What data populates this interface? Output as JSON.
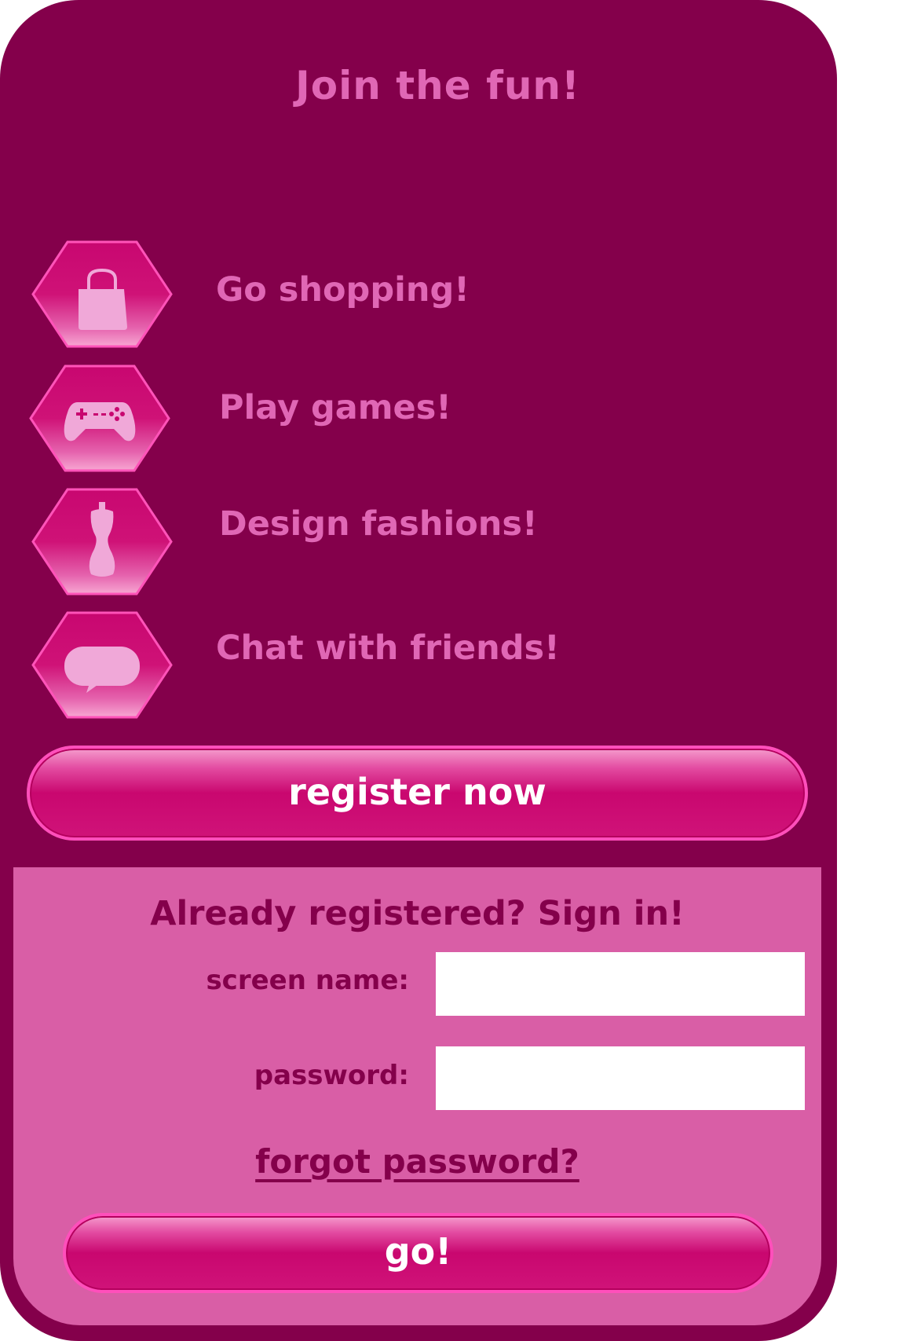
{
  "header": {
    "title": "Join the fun!"
  },
  "features": [
    {
      "label": "Go shopping!",
      "icon": "shopping-bag-icon"
    },
    {
      "label": "Play games!",
      "icon": "gamepad-icon"
    },
    {
      "label": "Design fashions!",
      "icon": "dress-form-icon"
    },
    {
      "label": "Chat with friends!",
      "icon": "chat-bubble-icon"
    }
  ],
  "register_button": {
    "label": "register now"
  },
  "signin": {
    "title": "Already registered? Sign in!",
    "screen_name_label": "screen name:",
    "screen_name_value": "",
    "password_label": "password:",
    "password_value": "",
    "forgot_link": "forgot password?",
    "go_label": "go!"
  },
  "colors": {
    "panel": "#84004b",
    "accent_text": "#e067b5",
    "signin_bg": "#d95ea6",
    "button": "#c9076f",
    "button_border": "#ff4fbb"
  }
}
